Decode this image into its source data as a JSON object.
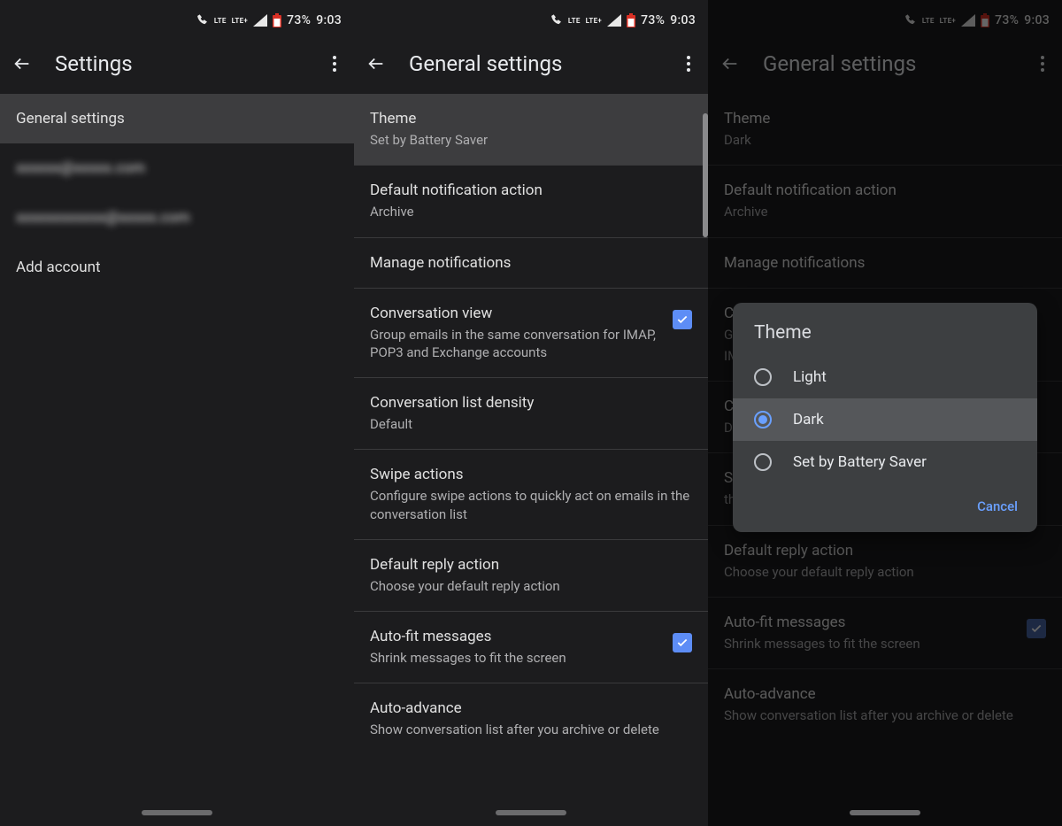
{
  "status": {
    "battery_pct": "73%",
    "clock": "9:03",
    "lte1": "LTE",
    "lte2": "LTE+"
  },
  "p1": {
    "title": "Settings",
    "general": "General settings",
    "account1": "xxxxxx@xxxxx.com",
    "account2": "xxxxxxxxxxxx@xxxxx.com",
    "add_account": "Add account"
  },
  "p2": {
    "title": "General settings",
    "theme_label": "Theme",
    "theme_value": "Set by Battery Saver",
    "notif_action_label": "Default notification action",
    "notif_action_value": "Archive",
    "manage_notifications": "Manage notifications",
    "conv_view_label": "Conversation view",
    "conv_view_sub": "Group emails in the same conversation for IMAP, POP3 and Exchange accounts",
    "density_label": "Conversation list density",
    "density_value": "Default",
    "swipe_label": "Swipe actions",
    "swipe_sub": "Configure swipe actions to quickly act on emails in the conversation list",
    "reply_label": "Default reply action",
    "reply_sub": "Choose your default reply action",
    "autofit_label": "Auto-fit messages",
    "autofit_sub": "Shrink messages to fit the screen",
    "autoadv_label": "Auto-advance",
    "autoadv_sub": "Show conversation list after you archive or delete"
  },
  "p3": {
    "title": "General settings",
    "theme_label": "Theme",
    "theme_value": "Dark",
    "notif_action_label": "Default notification action",
    "notif_action_value": "Archive",
    "manage_notifications": "Manage notifications",
    "conv_view_label": "C",
    "conv_view_sub1": "G",
    "conv_view_sub2": "IM",
    "density_label": "C",
    "density_value": "D",
    "swipe_label": "S",
    "swipe_sub": "th",
    "reply_label": "Default reply action",
    "reply_sub": "Choose your default reply action",
    "autofit_label": "Auto-fit messages",
    "autofit_sub": "Shrink messages to fit the screen",
    "autoadv_label": "Auto-advance",
    "autoadv_sub": "Show conversation list after you archive or delete"
  },
  "dialog": {
    "title": "Theme",
    "opt_light": "Light",
    "opt_dark": "Dark",
    "opt_battery": "Set by Battery Saver",
    "cancel": "Cancel"
  }
}
